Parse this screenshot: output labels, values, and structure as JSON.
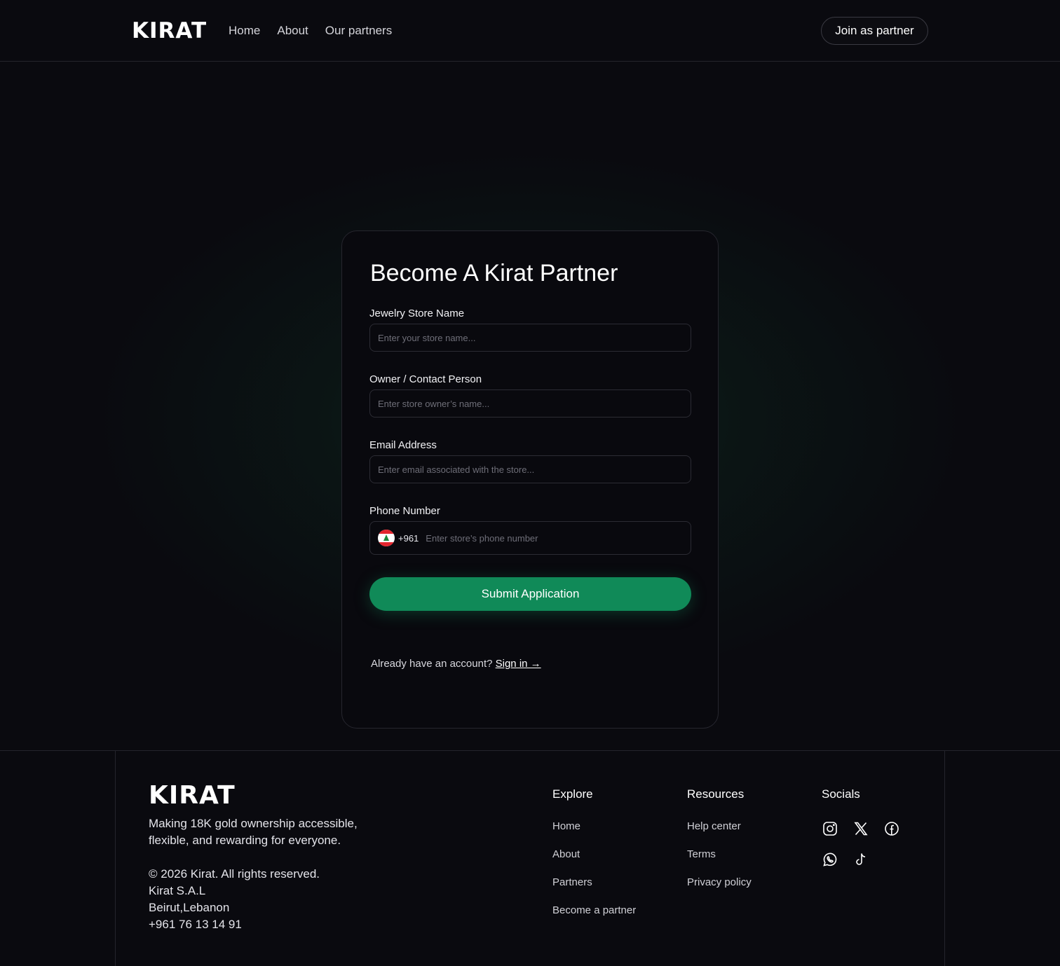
{
  "header": {
    "logo": "KIRAT",
    "nav": [
      "Home",
      "About",
      "Our partners"
    ],
    "join_button": "Join as partner"
  },
  "form": {
    "title": "Become A Kirat Partner",
    "fields": [
      {
        "label": "Jewelry Store Name",
        "placeholder": "Enter your store name...",
        "value": ""
      },
      {
        "label": "Owner / Contact Person",
        "placeholder": "Enter store owner’s name...",
        "value": ""
      },
      {
        "label": "Email Address",
        "placeholder": "Enter email associated with the store...",
        "value": ""
      }
    ],
    "phone": {
      "label": "Phone Number",
      "dial_code": "+961",
      "placeholder": "Enter store’s phone number",
      "flag_icon": "lebanon-flag-icon"
    },
    "submit_label": "Submit Application",
    "signin_prompt": "Already have an account?",
    "signin_link": "Sign in →"
  },
  "footer": {
    "logo": "KIRAT",
    "tagline": "Making 18K gold ownership accessible, flexible, and rewarding for everyone.",
    "copyright": "© 2026 Kirat. All rights reserved.",
    "company": "Kirat S.A.L",
    "location": "Beirut,Lebanon",
    "phone": "+961 76 13 14 91",
    "explore": {
      "title": "Explore",
      "links": [
        "Home",
        "About",
        "Partners",
        "Become a partner"
      ]
    },
    "resources": {
      "title": "Resources",
      "links": [
        "Help center",
        "Terms",
        "Privacy policy"
      ]
    },
    "socials": {
      "title": "Socials",
      "icons": [
        "instagram-icon",
        "x-icon",
        "facebook-icon",
        "whatsapp-icon",
        "tiktok-icon"
      ]
    }
  },
  "colors": {
    "background": "#0a0a0f",
    "accent": "#108a58",
    "border": "#2c2c34"
  }
}
